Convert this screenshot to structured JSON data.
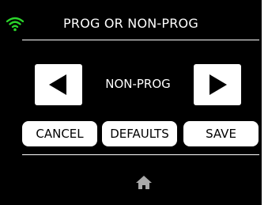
{
  "header": {
    "title": "PROG OR NON-PROG",
    "wifi_icon": "wifi-icon",
    "wifi_color": "#2bd62b"
  },
  "selector": {
    "value": "NON-PROG",
    "prev_icon": "triangle-left-icon",
    "next_icon": "triangle-right-icon"
  },
  "actions": {
    "cancel_label": "CANCEL",
    "defaults_label": "DEFAULTS",
    "save_label": "SAVE"
  },
  "footer": {
    "home_icon": "home-icon"
  },
  "colors": {
    "background": "#000000",
    "button": "#ffffff",
    "text": "#ffffff"
  }
}
